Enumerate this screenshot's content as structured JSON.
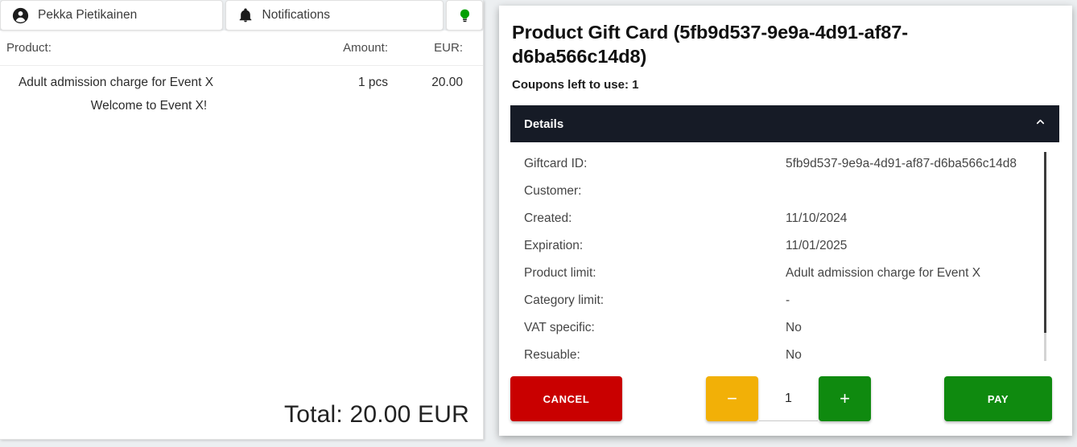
{
  "tabs": [
    {
      "id": "account",
      "label": "Pekka Pietikainen",
      "icon": "account-circle-icon"
    },
    {
      "id": "notifications",
      "label": "Notifications",
      "icon": "bell-icon"
    },
    {
      "id": "hint",
      "label": "",
      "icon": "lightbulb-icon"
    }
  ],
  "receipt": {
    "columns": {
      "product": "Product:",
      "amount": "Amount:",
      "currency": "EUR:"
    },
    "rows": [
      {
        "name": "Adult admission charge for Event X",
        "amount": "1 pcs",
        "price": "20.00",
        "note": "Welcome to Event X!"
      }
    ],
    "total": "Total: 20.00 EUR"
  },
  "dialog": {
    "title": "Product Gift Card (5fb9d537-9e9a-4d91-af87-d6ba566c14d8)",
    "coupons_left": "Coupons left to use: 1",
    "accordion": {
      "label": "Details",
      "expanded": true,
      "toggle_icon": "chevron-up-icon"
    },
    "details": [
      {
        "key": "Giftcard ID:",
        "value": "5fb9d537-9e9a-4d91-af87-d6ba566c14d8"
      },
      {
        "key": "Customer:",
        "value": ""
      },
      {
        "key": "Created:",
        "value": "11/10/2024"
      },
      {
        "key": "Expiration:",
        "value": "11/01/2025"
      },
      {
        "key": "Product limit:",
        "value": "Adult admission charge for Event X"
      },
      {
        "key": "Category limit:",
        "value": "-"
      },
      {
        "key": "VAT specific:",
        "value": "No"
      },
      {
        "key": "Resuable:",
        "value": "No"
      }
    ],
    "actions": {
      "cancel": "CANCEL",
      "pay": "PAY",
      "minus": "−",
      "plus": "+",
      "quantity": "1"
    }
  },
  "colors": {
    "cancel": "#c90000",
    "pay": "#0f8a0f",
    "minus": "#f2b007",
    "plus": "#0f8a0f",
    "accordion_bar": "#161b26",
    "lightbulb": "#00a000",
    "page_bg": "#eceff1"
  }
}
